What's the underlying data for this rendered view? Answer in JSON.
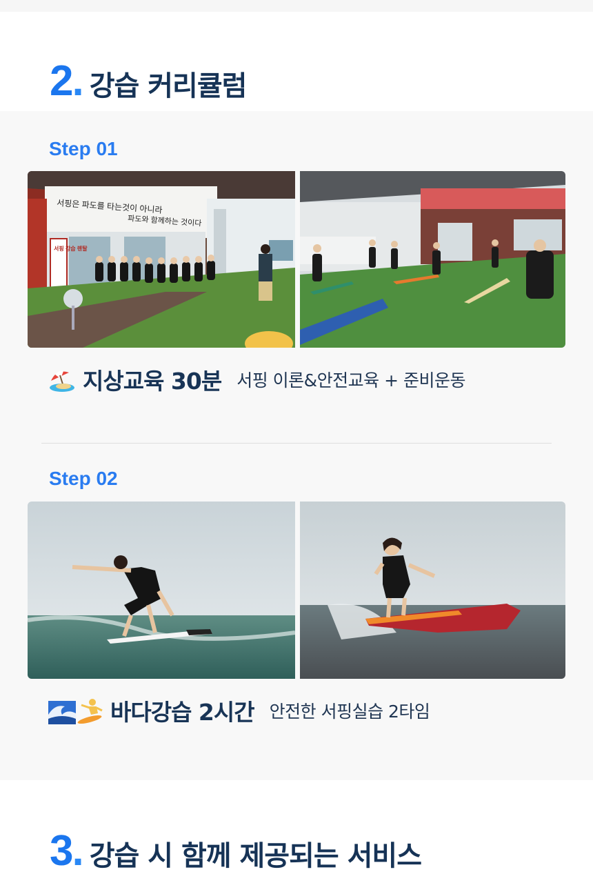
{
  "section2": {
    "number": "2",
    "dot": ".",
    "title": "강습 커리큘럼"
  },
  "steps": [
    {
      "label": "Step 01",
      "title": "지상교육 30분",
      "desc": "서핑 이론&안전교육 + 준비운동",
      "emoji": "beach-umbrella-icon"
    },
    {
      "label": "Step 02",
      "title": "바다강습 2시간",
      "desc": "안전한 서핑실습 2타임",
      "emoji": "wave-surfer-icon"
    }
  ],
  "photo_text": {
    "wall_sign_line1": "서핑은 파도를 타는것이 아니라",
    "wall_sign_line2": "파도와 함께하는 것이다",
    "banner": "서핑 강습 렌탈"
  },
  "section3": {
    "number": "3",
    "dot": ".",
    "title": "강습 시 함께 제공되는 서비스"
  },
  "colors": {
    "accent": "#1b76ee",
    "title": "#163356",
    "step": "#2a7cf0",
    "panel_bg": "#f8f8f8"
  }
}
